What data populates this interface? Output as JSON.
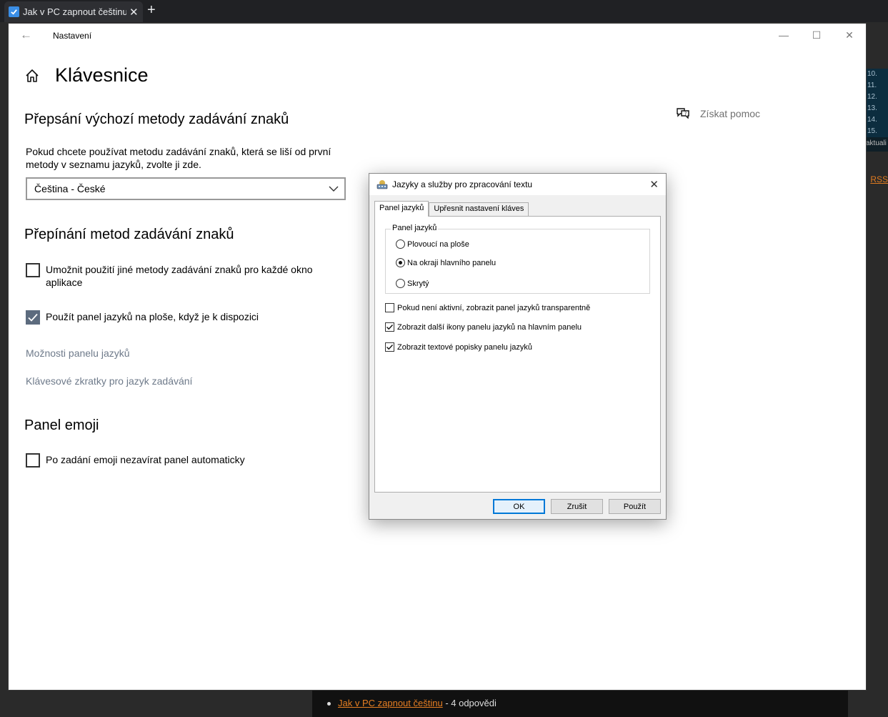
{
  "browser": {
    "tab_title": "Jak v PC zapnout češtinu",
    "right_panel_numbers": [
      "10.",
      "11.",
      "12.",
      "13.",
      "14.",
      "15."
    ],
    "right_panel_text": "aktuali",
    "rss_label": "RSS",
    "bottom_item": {
      "link": "Jak v PC zapnout češtinu",
      "suffix": " - 4 odpovědi"
    }
  },
  "settings": {
    "window_title": "Nastavení",
    "page_title": "Klávesnice",
    "help_link": "Získat pomoc",
    "section_override": {
      "heading": "Přepsání výchozí metody zadávání znaků",
      "description": "Pokud chcete používat metodu zadávání znaků, která se liší od první metody v seznamu jazyků, zvolte ji zde.",
      "dropdown_value": "Čeština - České"
    },
    "section_switching": {
      "heading": "Přepínání metod zadávání znaků",
      "checkbox_per_app": {
        "label": "Umožnit použití jiné metody zadávání znaků pro každé okno aplikace",
        "checked": false
      },
      "checkbox_langbar": {
        "label": "Použít panel jazyků na ploše, když je k dispozici",
        "checked": true
      },
      "link_options": "Možnosti panelu jazyků",
      "link_shortcuts": "Klávesové zkratky pro jazyk zadávání"
    },
    "section_emoji": {
      "heading": "Panel emoji",
      "checkbox_keep_open": {
        "label": "Po zadání emoji nezavírat panel automaticky",
        "checked": false
      }
    }
  },
  "dialog": {
    "title": "Jazyky a služby pro zpracování textu",
    "tabs": [
      "Panel jazyků",
      "Upřesnit nastavení kláves"
    ],
    "active_tab": "Panel jazyků",
    "group_label": "Panel jazyků",
    "radios": [
      {
        "label": "Plovoucí na ploše",
        "checked": false
      },
      {
        "label": "Na okraji hlavního panelu",
        "checked": true
      },
      {
        "label": "Skrytý",
        "checked": false
      }
    ],
    "checkboxes": [
      {
        "label": "Pokud není aktivní, zobrazit panel jazyků transparentně",
        "checked": false
      },
      {
        "label": "Zobrazit další ikony panelu jazyků na hlavním panelu",
        "checked": true
      },
      {
        "label": "Zobrazit textové popisky panelu jazyků",
        "checked": true
      }
    ],
    "buttons": {
      "ok": "OK",
      "cancel": "Zrušit",
      "apply": "Použít"
    }
  },
  "colors": {
    "accent_checkbox": "#5c6b7e",
    "link_gray": "#6e7a8a",
    "dialog_default_button": "#0078d7",
    "bg_link_orange": "#e67e22"
  }
}
